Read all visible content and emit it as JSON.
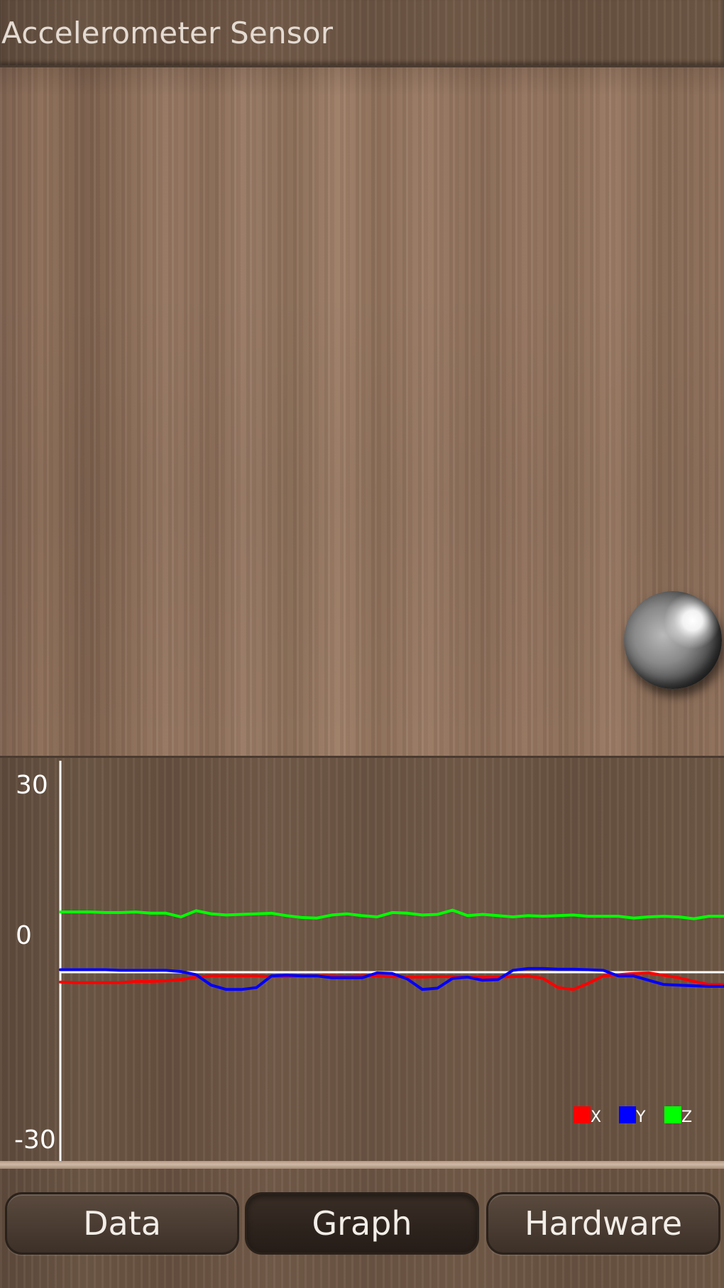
{
  "app": {
    "title": "Accelerometer Sensor"
  },
  "graph": {
    "legend": [
      {
        "label": "X",
        "color": "#ff0000"
      },
      {
        "label": "Y",
        "color": "#0000ff"
      },
      {
        "label": "Z",
        "color": "#00ff00"
      }
    ]
  },
  "chart_data": {
    "type": "line",
    "title": "",
    "xlabel": "",
    "ylabel": "",
    "ylim": [
      -30,
      30
    ],
    "y_tick_labels": [
      "30",
      "0",
      "-30"
    ],
    "grid": false,
    "legend_position": "bottom-right",
    "series": [
      {
        "name": "X",
        "color": "#ff0000",
        "values": [
          -1.6,
          -1.7,
          -1.7,
          -1.7,
          -1.7,
          -1.5,
          -1.5,
          -1.4,
          -1.2,
          -0.8,
          -0.6,
          -0.6,
          -0.6,
          -0.6,
          -0.7,
          -0.7,
          -0.6,
          -0.6,
          -0.6,
          -0.7,
          -0.6,
          -0.6,
          -0.7,
          -0.8,
          -0.8,
          -0.7,
          -0.7,
          -0.8,
          -0.8,
          -0.8,
          -0.7,
          -0.6,
          -1.0,
          -2.5,
          -2.8,
          -1.8,
          -0.6,
          -0.4,
          -0.2,
          -0.1,
          -0.5,
          -0.9,
          -1.5,
          -2.0,
          -2.0
        ]
      },
      {
        "name": "Y",
        "color": "#0000ff",
        "values": [
          0.4,
          0.4,
          0.4,
          0.4,
          0.3,
          0.3,
          0.3,
          0.3,
          0.1,
          -0.4,
          -2.1,
          -2.8,
          -2.8,
          -2.5,
          -0.6,
          -0.5,
          -0.6,
          -0.6,
          -0.9,
          -0.9,
          -0.9,
          -0.1,
          -0.2,
          -1.1,
          -2.8,
          -2.6,
          -1.0,
          -0.8,
          -1.3,
          -1.2,
          0.3,
          0.6,
          0.6,
          0.5,
          0.5,
          0.4,
          0.3,
          -0.6,
          -0.6,
          -1.3,
          -2.0,
          -2.1,
          -2.2,
          -2.3,
          -2.3
        ]
      },
      {
        "name": "Z",
        "color": "#00ff00",
        "values": [
          9.8,
          9.8,
          9.8,
          9.7,
          9.7,
          9.8,
          9.6,
          9.6,
          9.0,
          10.0,
          9.5,
          9.3,
          9.4,
          9.5,
          9.6,
          9.2,
          8.9,
          8.8,
          9.3,
          9.5,
          9.2,
          9.0,
          9.7,
          9.6,
          9.3,
          9.4,
          10.1,
          9.2,
          9.4,
          9.2,
          9.0,
          9.2,
          9.1,
          9.2,
          9.3,
          9.1,
          9.1,
          9.1,
          8.8,
          9.0,
          9.1,
          9.0,
          8.7,
          9.1,
          9.1
        ]
      }
    ]
  },
  "tabs": [
    {
      "label": "Data",
      "active": false
    },
    {
      "label": "Graph",
      "active": true
    },
    {
      "label": "Hardware",
      "active": false
    }
  ]
}
